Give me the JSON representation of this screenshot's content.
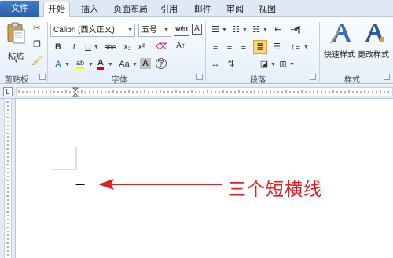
{
  "tabs": {
    "file": "文件",
    "home": "开始",
    "insert": "插入",
    "layout": "页面布局",
    "references": "引用",
    "mailings": "邮件",
    "review": "审阅",
    "view": "视图"
  },
  "clipboard": {
    "paste_label": "粘贴",
    "group_label": "剪贴板"
  },
  "font": {
    "name": "Calibri (西文正文)",
    "size": "五号",
    "group_label": "字体",
    "wen_icon": "wén",
    "bold": "B",
    "italic": "I",
    "underline": "U",
    "strike": "abc",
    "subscript": "x₂",
    "superscript": "x²",
    "font_color_letter": "A",
    "highlight_letter": "ab",
    "change_case": "Aa",
    "border_letter": "A",
    "char_shade_letter": "A",
    "enclose_char": "字"
  },
  "paragraph": {
    "group_label": "段落"
  },
  "styles": {
    "quick_styles_label": "快速样式",
    "change_styles_label": "更改样式",
    "group_label": "样式"
  },
  "document": {
    "dashes": "---",
    "annotation": "三个短横线"
  },
  "colors": {
    "annotation_red": "#e02020",
    "tab_file_blue": "#2f6cbf",
    "font_color_red": "#e00000",
    "highlight_yellow": "#ffff00"
  }
}
